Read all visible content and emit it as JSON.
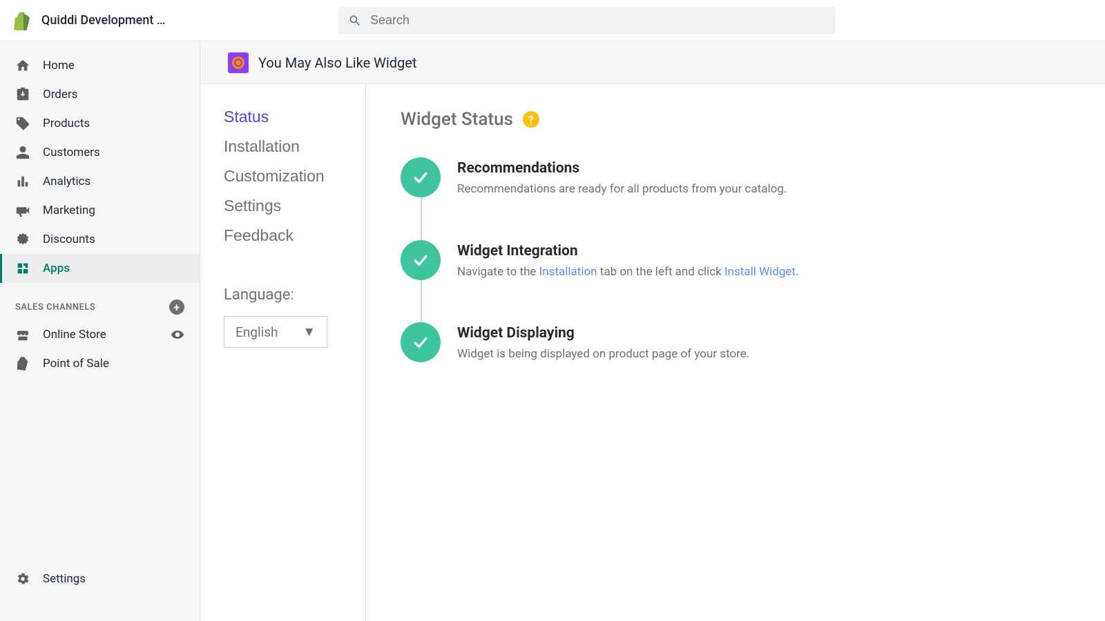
{
  "header": {
    "store_name": "Quiddi Development St…",
    "search_placeholder": "Search"
  },
  "sidebar": {
    "home": "Home",
    "orders": "Orders",
    "products": "Products",
    "customers": "Customers",
    "analytics": "Analytics",
    "marketing": "Marketing",
    "discounts": "Discounts",
    "apps": "Apps",
    "sales_channels_header": "SALES CHANNELS",
    "online_store": "Online Store",
    "point_of_sale": "Point of Sale",
    "settings": "Settings"
  },
  "app": {
    "title": "You May Also Like Widget",
    "nav": {
      "status": "Status",
      "installation": "Installation",
      "customization": "Customization",
      "settings": "Settings",
      "feedback": "Feedback"
    },
    "language_label": "Language:",
    "language_value": "English"
  },
  "content": {
    "title": "Widget Status",
    "steps": {
      "s1_title": "Recommendations",
      "s1_desc": "Recommendations are ready for all products from your catalog.",
      "s2_title": "Widget Integration",
      "s2_pre": "Navigate to the ",
      "s2_link1": "Installation",
      "s2_mid": " tab on the left and click ",
      "s2_link2": "Install Widget",
      "s2_post": ".",
      "s3_title": "Widget Displaying",
      "s3_desc": "Widget is being displayed on product page of your store."
    }
  }
}
